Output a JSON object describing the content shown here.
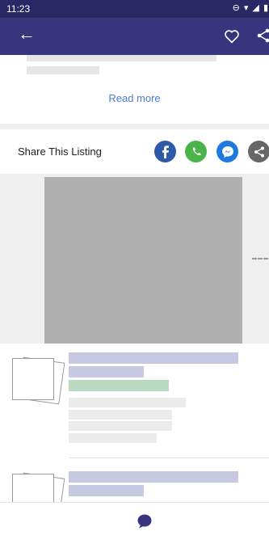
{
  "status_bar": {
    "time": "11:23",
    "icons": "⊖ ▾ ◢ ▮"
  },
  "app_bar": {
    "back_icon": "arrow-left-icon",
    "favorite_icon": "heart-icon",
    "share_icon": "share-icon"
  },
  "description": {
    "read_more_label": "Read more"
  },
  "share": {
    "label": "Share This Listing",
    "buttons": [
      "facebook",
      "whatsapp",
      "messenger",
      "share"
    ]
  },
  "colors": {
    "status_bar": "#2a2864",
    "app_bar": "#38357f",
    "link": "#4a7bd8",
    "facebook": "#2f5aa8",
    "whatsapp": "#4cb34a",
    "messenger": "#1f7ae0",
    "generic_share": "#676767",
    "chat": "#38357f"
  }
}
